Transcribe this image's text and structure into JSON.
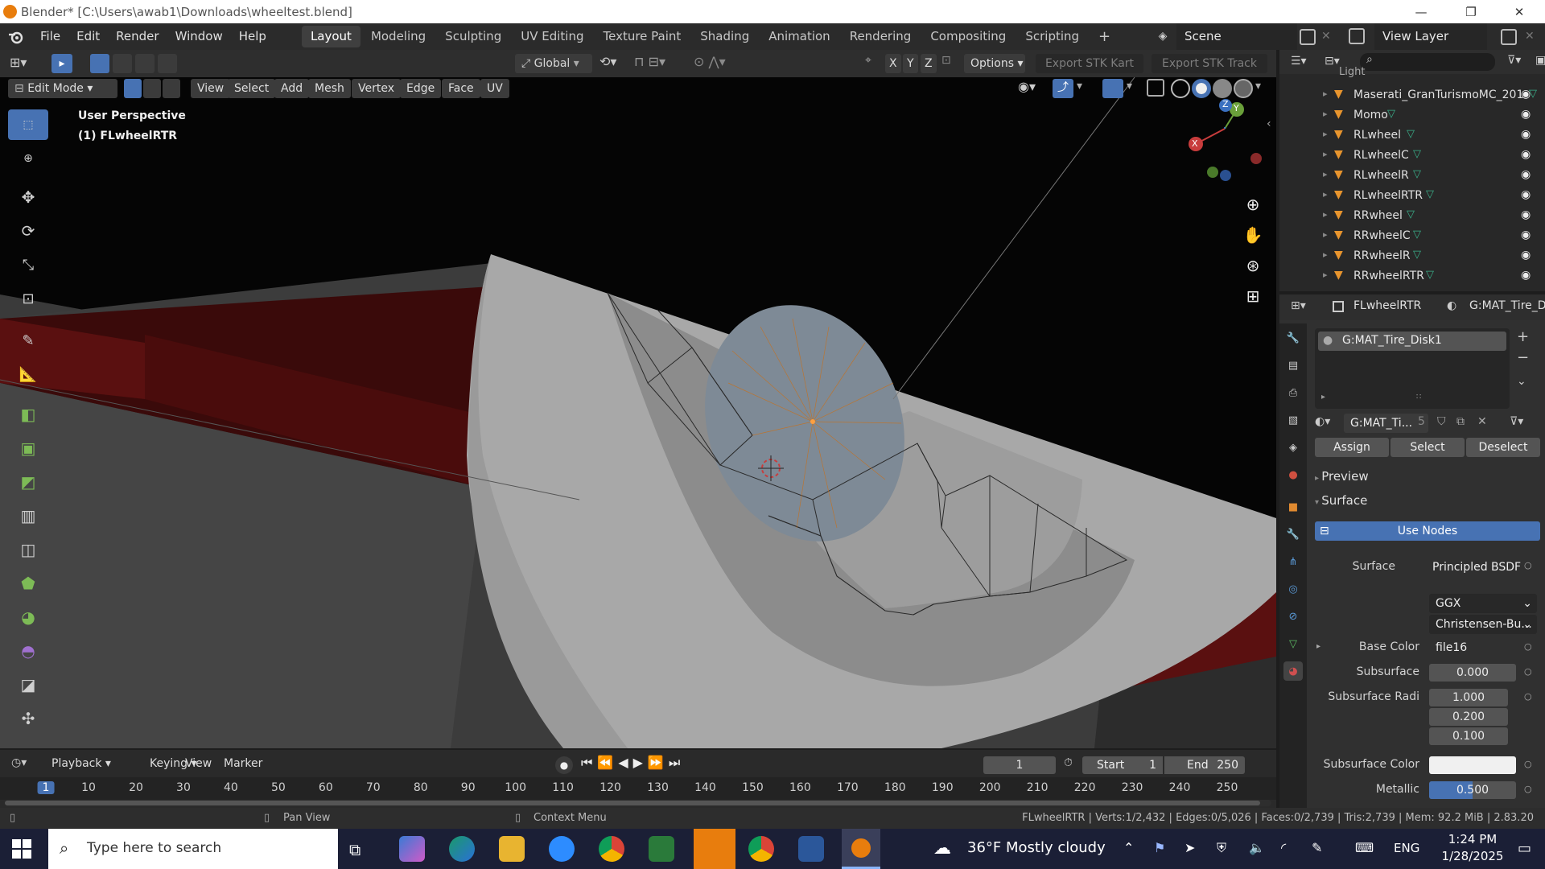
{
  "window": {
    "title": "Blender* [C:\\Users\\awab1\\Downloads\\wheeltest.blend]",
    "minimize": "—",
    "maximize": "❐",
    "close": "✕"
  },
  "menus": [
    "File",
    "Edit",
    "Render",
    "Window",
    "Help"
  ],
  "workspaces": [
    "Layout",
    "Modeling",
    "Sculpting",
    "UV Editing",
    "Texture Paint",
    "Shading",
    "Animation",
    "Rendering",
    "Compositing",
    "Scripting"
  ],
  "active_workspace": "Layout",
  "scene": {
    "label": "Scene",
    "view_layer": "View Layer"
  },
  "tool_header": {
    "transform_orientation": "Global",
    "axes": [
      "X",
      "Y",
      "Z"
    ],
    "options": "Options",
    "export_kart": "Export STK Kart",
    "export_track": "Export STK Track"
  },
  "viewport_header": {
    "mode": "Edit Mode",
    "menus": [
      "View",
      "Select",
      "Add",
      "Mesh",
      "Vertex",
      "Edge",
      "Face",
      "UV"
    ]
  },
  "viewport": {
    "perspective": "User Perspective",
    "object": "(1) FLwheelRTR",
    "gizmo_axes": [
      "X",
      "Y",
      "Z"
    ]
  },
  "outliner": {
    "partial_top": "Light",
    "items": [
      "Maserati_GranTurismoMC_201",
      "Momo",
      "RLwheel",
      "RLwheelC",
      "RLwheelR",
      "RLwheelRTR",
      "RRwheel",
      "RRwheelC",
      "RRwheelR",
      "RRwheelRTR"
    ]
  },
  "properties": {
    "object": "FLwheelRTR",
    "material_header": "G:MAT_Tire_Di",
    "slot": "G:MAT_Tire_Disk1",
    "material_name": "G:MAT_Ti...",
    "users": "5",
    "assign": "Assign",
    "select": "Select",
    "deselect": "Deselect",
    "preview": "Preview",
    "surface_panel": "Surface",
    "use_nodes": "Use Nodes",
    "surface_label": "Surface",
    "surface_value": "Principled BSDF",
    "distribution": "GGX",
    "subsurface_method": "Christensen-Bu...",
    "base_color_label": "Base Color",
    "base_color_value": "file16",
    "subsurface_label": "Subsurface",
    "subsurface_value": "0.000",
    "subsurface_radius_label": "Subsurface Radi",
    "subsurface_radius": [
      "1.000",
      "0.200",
      "0.100"
    ],
    "subsurface_color_label": "Subsurface Color",
    "metallic_label": "Metallic",
    "metallic_value": "0.500",
    "metallic_fraction": 0.5
  },
  "timeline": {
    "menus": [
      "Playback",
      "Keying",
      "View",
      "Marker"
    ],
    "current_frame": "1",
    "start_label": "Start",
    "start": "1",
    "end_label": "End",
    "end": "250",
    "ruler": [
      "1",
      "10",
      "20",
      "30",
      "40",
      "50",
      "60",
      "70",
      "80",
      "90",
      "100",
      "110",
      "120",
      "130",
      "140",
      "150",
      "160",
      "170",
      "180",
      "190",
      "200",
      "210",
      "220",
      "230",
      "240",
      "250"
    ]
  },
  "status_bar": {
    "pan": "Pan View",
    "context": "Context Menu",
    "stats": "FLwheelRTR | Verts:1/2,432 | Edges:0/5,026 | Faces:0/2,739 | Tris:2,739 | Mem: 92.2 MiB | 2.83.20"
  },
  "taskbar": {
    "search_placeholder": "Type here to search",
    "weather": "36°F  Mostly cloudy",
    "language": "ENG",
    "time": "1:24 PM",
    "date": "1/28/2025"
  },
  "colors": {
    "accent_blue": "#4772b3",
    "blender_orange": "#e87d0d",
    "header_bg": "#2e2e2e",
    "viewport_bg": "#3a3a3a"
  }
}
